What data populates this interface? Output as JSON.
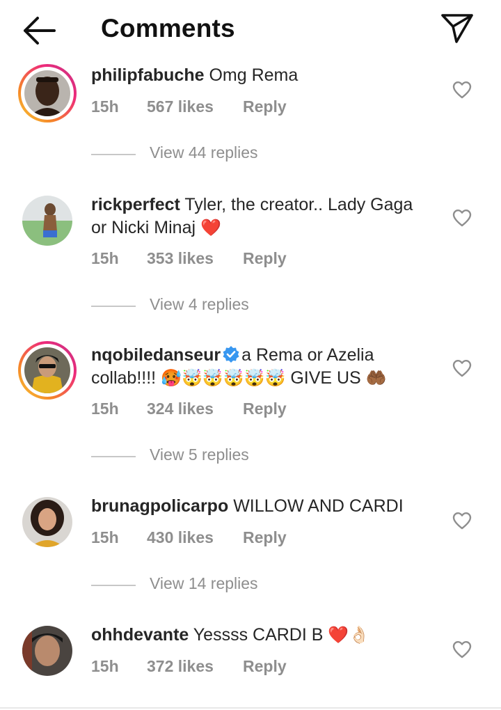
{
  "header": {
    "title": "Comments",
    "back_icon": "arrow-left-icon",
    "send_icon": "paper-plane-icon"
  },
  "comments": [
    {
      "username": "philipfabuche",
      "text": "Omg Rema",
      "time": "15h",
      "likes": "567 likes",
      "reply": "Reply",
      "view_replies": "View 44 replies",
      "story_ring": true
    },
    {
      "username": "rickperfect",
      "text": "Tyler, the creator.. Lady Gaga or Nicki Minaj",
      "emoji": "❤️",
      "time": "15h",
      "likes": "353 likes",
      "reply": "Reply",
      "view_replies": "View 4 replies",
      "story_ring": false
    },
    {
      "username": "nqobiledanseur",
      "verified": true,
      "text_a": "a Rema or Azelia",
      "text_b": "collab!!!!",
      "emoji_a": "🥵🤯🤯🤯🤯🤯",
      "text_c": "GIVE US",
      "emoji_b": "🤲🏾",
      "time": "15h",
      "likes": "324 likes",
      "reply": "Reply",
      "view_replies": "View 5 replies",
      "story_ring": true
    },
    {
      "username": "brunagpolicarpo",
      "text": "WILLOW AND CARDI",
      "time": "15h",
      "likes": "430 likes",
      "reply": "Reply",
      "view_replies": "View 14 replies",
      "story_ring": false
    },
    {
      "username": "ohhdevante",
      "text": "Yessss CARDI B",
      "emoji": "❤️👌🏻",
      "time": "15h",
      "likes": "372 likes",
      "reply": "Reply",
      "story_ring": false
    }
  ]
}
